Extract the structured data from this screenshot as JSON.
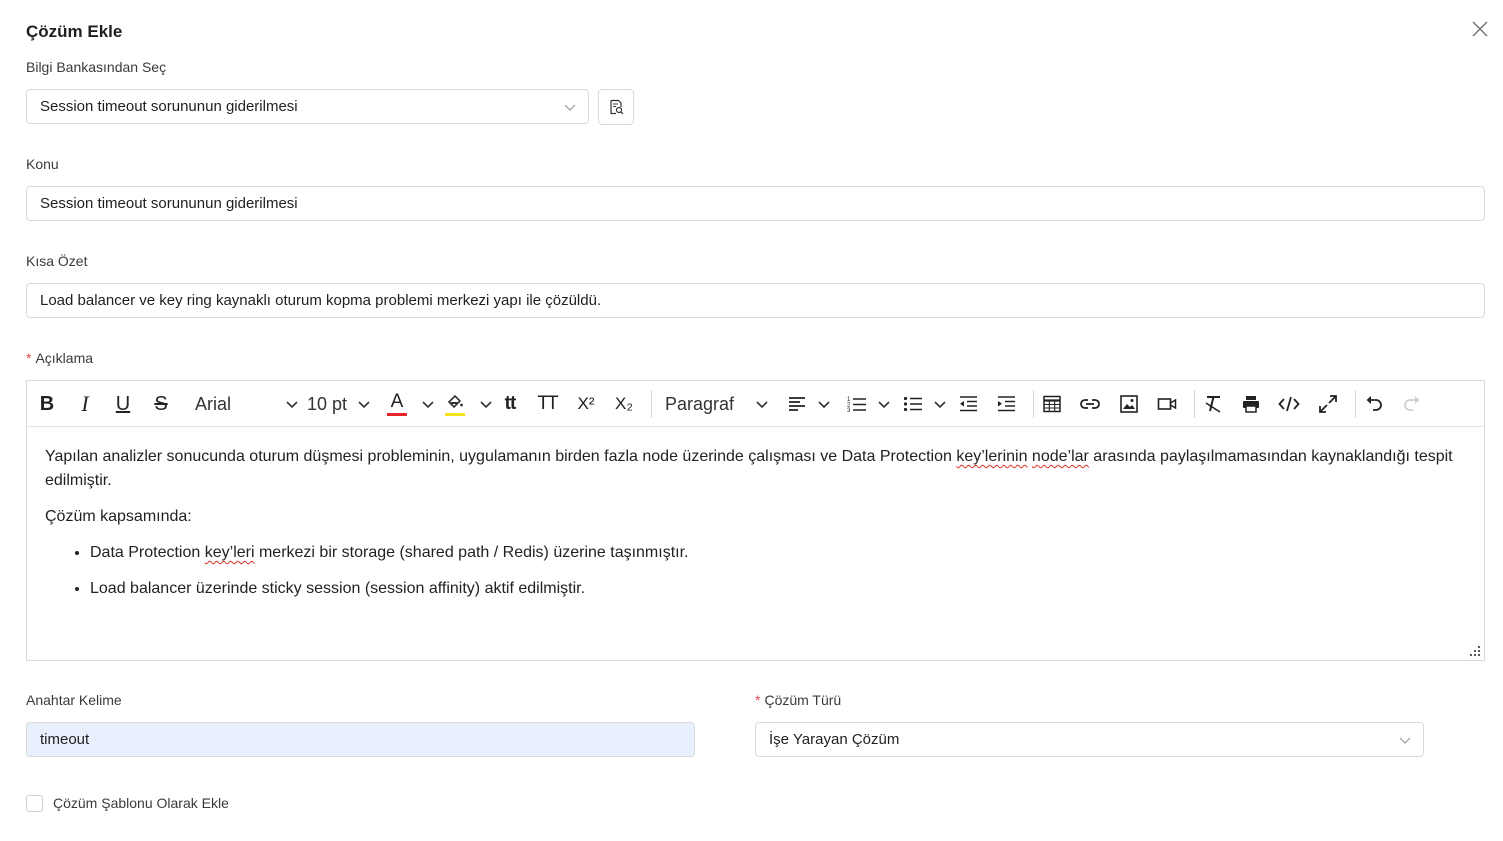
{
  "dialog": {
    "title": "Çözüm Ekle"
  },
  "kb_select": {
    "label": "Bilgi Bankasından Seç",
    "value": "Session timeout sorununun giderilmesi"
  },
  "konu": {
    "label": "Konu",
    "value": "Session timeout sorununun giderilmesi"
  },
  "ozet": {
    "label": "Kısa Özet",
    "value": "Load balancer ve key ring kaynaklı oturum kopma problemi merkezi yapı ile çözüldü."
  },
  "aciklama": {
    "required_mark": "*",
    "label": "Açıklama",
    "toolbar": {
      "bold": "B",
      "italic": "I",
      "underline": "U",
      "strike": "S",
      "font_family": "Arial",
      "font_size": "10 pt",
      "text_color": "A",
      "text_color_value": "#e5252a",
      "highlight_color_value": "#f4e21a",
      "case": "tt",
      "format_text": "TT",
      "superscript": "X²",
      "subscript": "X₂",
      "block_format": "Paragraf"
    },
    "content": {
      "p1_a": "Yapılan analizler sonucunda oturum düşmesi probleminin, uygulamanın birden fazla node üzerinde çalışması ve Data Protection ",
      "p1_spell1": "key’lerinin",
      "p1_b": " ",
      "p1_spell2": "node’lar",
      "p1_c": " arasında paylaşılmamasından kaynaklandığı tespit edilmiştir.",
      "p2": "Çözüm kapsamında:",
      "li1_a": "Data Protection ",
      "li1_spell": "key’leri",
      "li1_b": " merkezi bir storage (shared path / Redis) üzerine taşınmıştır.",
      "li2": "Load balancer üzerinde sticky session (session affinity) aktif edilmiştir."
    }
  },
  "anahtar": {
    "label": "Anahtar Kelime",
    "value": "timeout"
  },
  "cozum_turu": {
    "required_mark": "*",
    "label": "Çözüm Türü",
    "value": "İşe Yarayan Çözüm"
  },
  "template_checkbox": {
    "label": "Çözüm Şablonu Olarak Ekle",
    "checked": false
  }
}
